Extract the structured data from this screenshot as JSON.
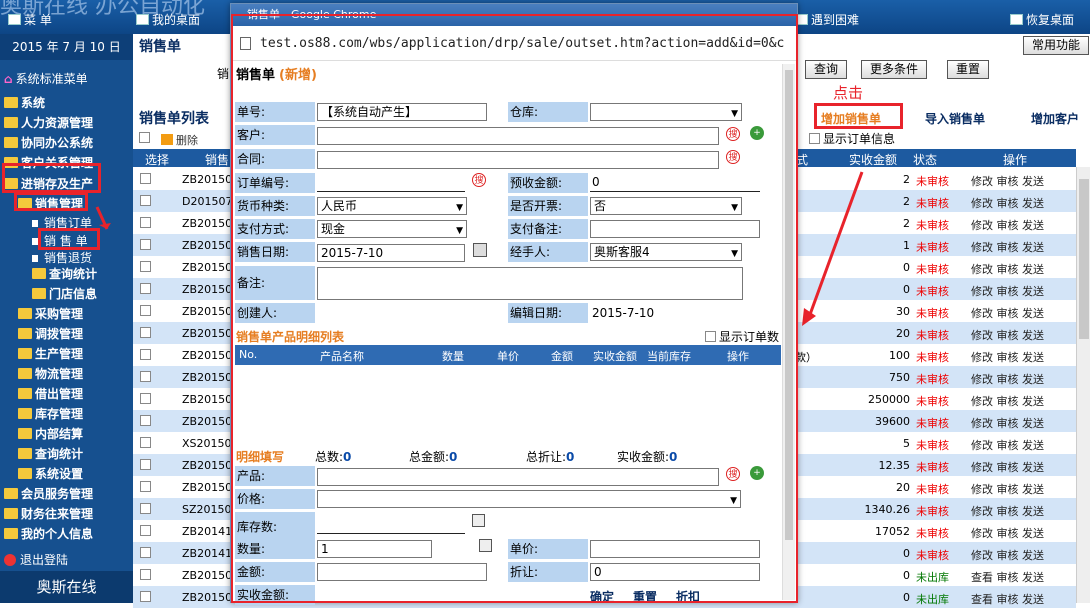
{
  "topbar": {
    "brand": "奥斯在线 办公自动化",
    "menu": "菜 单",
    "desk": "我的桌面",
    "trouble": "遇到困难",
    "restore": "恢复桌面"
  },
  "sidebar": {
    "date": "2015 年 7 月 10 日",
    "std_menu": "系统标准菜单",
    "items": [
      "系统",
      "人力资源管理",
      "协同办公系统",
      "客户关系管理",
      "进销存及生产"
    ],
    "sales_mgmt": "销售管理",
    "sub": [
      "销售订单",
      "销 售 单",
      "销售退货"
    ],
    "more": [
      "查询统计",
      "门店信息"
    ],
    "modules": [
      "采购管理",
      "调拨管理",
      "生产管理",
      "物流管理",
      "借出管理",
      "库存管理",
      "内部结算",
      "查询统计",
      "系统设置"
    ],
    "tail": [
      "会员服务管理",
      "财务往来管理",
      "我的个人信息"
    ],
    "logout": "退出登陆",
    "footer": "奥斯在线"
  },
  "main": {
    "title": "销售单",
    "common": "常用功能",
    "label_fragment": "销",
    "query": "查询",
    "more_cond": "更多条件",
    "reset": "重置",
    "annot": "点击",
    "list_title": "销售单列表",
    "delete": "删除",
    "add_sale": "增加销售单",
    "import_sale": "导入销售单",
    "add_customer": "增加客户",
    "show_order": "显示订单信息",
    "cols": {
      "select": "选择",
      "sale": "销售",
      "fmt": "式",
      "amount": "实收金额",
      "status": "状态",
      "ops": "操作"
    },
    "rows": [
      {
        "code": "ZB201507",
        "amt": "2",
        "st": "未审核",
        "ops": "修改 审核 发送"
      },
      {
        "code": "D2015070",
        "amt": "2",
        "st": "未审核",
        "ops": "修改 审核 发送"
      },
      {
        "code": "ZB201507",
        "amt": "2",
        "st": "未审核",
        "ops": "修改 审核 发送"
      },
      {
        "code": "ZB201507",
        "amt": "1",
        "st": "未审核",
        "ops": "修改 审核 发送"
      },
      {
        "code": "ZB201506",
        "amt": "0",
        "st": "未审核",
        "ops": "修改 审核 发送"
      },
      {
        "code": "ZB201506",
        "amt": "0",
        "st": "未审核",
        "ops": "修改 审核 发送"
      },
      {
        "code": "ZB201505",
        "amt": "30",
        "st": "未审核",
        "ops": "修改 审核 发送"
      },
      {
        "code": "ZB201505",
        "amt": "20",
        "st": "未审核",
        "ops": "修改 审核 发送"
      },
      {
        "code": "ZB201504",
        "amt": "100",
        "st": "未审核",
        "ops": "修改 审核 发送",
        "extra": "款）"
      },
      {
        "code": "ZB201504",
        "amt": "750",
        "st": "未审核",
        "ops": "修改 审核 发送"
      },
      {
        "code": "ZB201503",
        "amt": "250000",
        "st": "未审核",
        "ops": "修改 审核 发送"
      },
      {
        "code": "ZB201503",
        "amt": "39600",
        "st": "未审核",
        "ops": "修改 审核 发送"
      },
      {
        "code": "XS201503",
        "amt": "5",
        "st": "未审核",
        "ops": "修改 审核 发送"
      },
      {
        "code": "ZB201503",
        "amt": "12.35",
        "st": "未审核",
        "ops": "修改 审核 发送"
      },
      {
        "code": "ZB201503",
        "amt": "20",
        "st": "未审核",
        "ops": "修改 审核 发送"
      },
      {
        "code": "SZ201503",
        "amt": "1340.26",
        "st": "未审核",
        "ops": "修改 审核 发送"
      },
      {
        "code": "ZB201411",
        "amt": "17052",
        "st": "未审核",
        "ops": "修改 审核 发送"
      },
      {
        "code": "ZB201411",
        "amt": "0",
        "st": "未审核",
        "ops": "修改 审核 发送"
      },
      {
        "code": "ZB201501",
        "amt": "0",
        "st": "未出库",
        "ops": "查看 审核 发送"
      },
      {
        "code": "ZB201501",
        "amt": "0",
        "st": "未出库",
        "ops": "查看 审核 发送"
      }
    ]
  },
  "popup": {
    "title": "销售单 - Google Chrome",
    "url": "test.os88.com/wbs/application/drp/sale/outset.htm?action=add&id=0&c",
    "heading": "销售单",
    "heading_sub": "(新增)",
    "f": {
      "no": "单号:",
      "no_val": "【系统自动产生】",
      "wh": "仓库:",
      "cust": "客户:",
      "contract": "合同:",
      "order_no": "订单编号:",
      "prepaid": "预收金额:",
      "prepaid_val": "0",
      "currency": "货币种类:",
      "currency_val": "人民币",
      "invoice": "是否开票:",
      "invoice_val": "否",
      "pay": "支付方式:",
      "pay_val": "现金",
      "pay_note": "支付备注:",
      "date": "销售日期:",
      "date_val": "2015-7-10",
      "handler": "经手人:",
      "handler_val": "奥斯客服4",
      "note": "备注:",
      "creator": "创建人:",
      "edit_date": "编辑日期:",
      "edit_date_val": "2015-7-10"
    },
    "detail_title": "销售单产品明细列表",
    "show_order": "显示订单数",
    "dcols": [
      "No.",
      "产品名称",
      "数量",
      "单价",
      "金额",
      "实收金额",
      "当前库存",
      "操作"
    ],
    "fill": "明细填写",
    "total_cnt": "总数:",
    "total_cnt_v": "0",
    "total_amt": "总金额:",
    "total_amt_v": "0",
    "total_disc": "总折让:",
    "total_disc_v": "0",
    "real_amt": "实收金额:",
    "real_amt_v": "0",
    "p": {
      "product": "产品:",
      "price": "价格:",
      "stock": "库存数:",
      "qty": "数量:",
      "qty_val": "1",
      "unit_price": "单价:",
      "amount": "金额:",
      "discount": "折让:",
      "discount_val": "0",
      "real": "实收金额:"
    },
    "btns": {
      "ok": "确定",
      "reset": "重置",
      "discount": "折扣"
    }
  }
}
